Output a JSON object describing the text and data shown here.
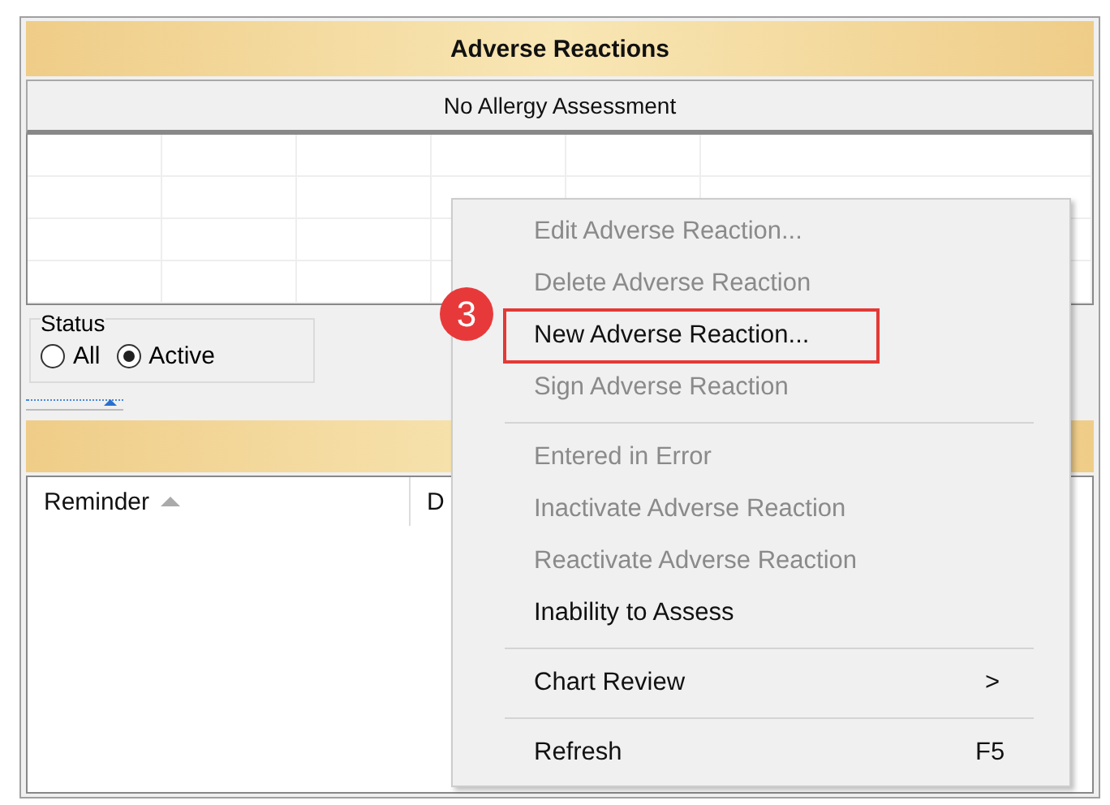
{
  "panel": {
    "title": "Adverse Reactions",
    "assessment_bar": "No Allergy Assessment"
  },
  "status": {
    "legend": "Status",
    "options": [
      {
        "label": "All",
        "selected": false
      },
      {
        "label": "Active",
        "selected": true
      }
    ]
  },
  "reminders": {
    "columns": [
      {
        "label": "Reminder",
        "sorted": true
      },
      {
        "label": "D",
        "sorted": false
      }
    ]
  },
  "callout": {
    "number": "3"
  },
  "context_menu": [
    {
      "kind": "item",
      "label": "Edit Adverse Reaction...",
      "disabled": true,
      "highlighted": false
    },
    {
      "kind": "item",
      "label": "Delete Adverse Reaction",
      "disabled": true,
      "highlighted": false
    },
    {
      "kind": "item",
      "label": "New Adverse Reaction...",
      "disabled": false,
      "highlighted": true
    },
    {
      "kind": "item",
      "label": "Sign Adverse Reaction",
      "disabled": true,
      "highlighted": false
    },
    {
      "kind": "separator"
    },
    {
      "kind": "item",
      "label": "Entered in Error",
      "disabled": true,
      "highlighted": false
    },
    {
      "kind": "item",
      "label": "Inactivate Adverse Reaction",
      "disabled": true,
      "highlighted": false
    },
    {
      "kind": "item",
      "label": "Reactivate Adverse Reaction",
      "disabled": true,
      "highlighted": false
    },
    {
      "kind": "item",
      "label": "Inability to Assess",
      "disabled": false,
      "highlighted": false
    },
    {
      "kind": "separator"
    },
    {
      "kind": "submenu",
      "label": "Chart Review",
      "arrow": ">",
      "disabled": false,
      "highlighted": false
    },
    {
      "kind": "separator"
    },
    {
      "kind": "item",
      "label": "Refresh",
      "shortcut": "F5",
      "disabled": false,
      "highlighted": false
    }
  ]
}
